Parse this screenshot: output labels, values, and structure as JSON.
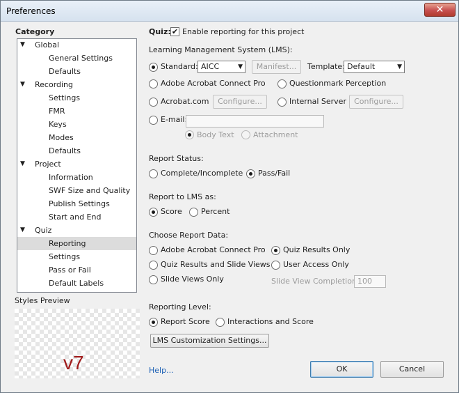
{
  "window": {
    "title": "Preferences",
    "close_glyph": "✕"
  },
  "category": {
    "heading": "Category",
    "items": [
      {
        "label": "Global",
        "group": true
      },
      {
        "label": "General Settings"
      },
      {
        "label": "Defaults"
      },
      {
        "label": "Recording",
        "group": true
      },
      {
        "label": "Settings"
      },
      {
        "label": "FMR"
      },
      {
        "label": "Keys"
      },
      {
        "label": "Modes"
      },
      {
        "label": "Defaults"
      },
      {
        "label": "Project",
        "group": true
      },
      {
        "label": "Information"
      },
      {
        "label": "SWF Size and Quality"
      },
      {
        "label": "Publish Settings"
      },
      {
        "label": "Start and End"
      },
      {
        "label": "Quiz",
        "group": true
      },
      {
        "label": "Reporting",
        "selected": true
      },
      {
        "label": "Settings"
      },
      {
        "label": "Pass or Fail"
      },
      {
        "label": "Default Labels"
      }
    ]
  },
  "styles_preview": {
    "label": "Styles Preview",
    "text": "v7"
  },
  "quiz": {
    "label": "Quiz:",
    "enable_label": "Enable reporting for this project",
    "checked": true,
    "check_glyph": "✔"
  },
  "lms": {
    "heading": "Learning Management System (LMS):",
    "standard_label": "Standard:",
    "standard_value": "AICC",
    "manifest_button": "Manifest...",
    "template_label": "Template:",
    "template_value": "Default",
    "acrobat_connect": "Adobe Acrobat Connect Pro",
    "questionmark": "Questionmark Perception",
    "acrobat_com": "Acrobat.com",
    "configure_button_1": "Configure...",
    "internal_server": "Internal Server",
    "configure_button_2": "Configure...",
    "email_label": "E-mail:",
    "email_value": "",
    "body_text": "Body Text",
    "attachment": "Attachment",
    "dropdown_glyph": "▼"
  },
  "report_status": {
    "heading": "Report Status:",
    "complete": "Complete/Incomplete",
    "passfail": "Pass/Fail"
  },
  "report_as": {
    "heading": "Report to LMS as:",
    "score": "Score",
    "percent": "Percent"
  },
  "report_data": {
    "heading": "Choose Report Data:",
    "acrobat_connect": "Adobe Acrobat Connect Pro",
    "quiz_results_only": "Quiz Results Only",
    "quiz_and_slides": "Quiz Results and Slide Views",
    "user_access_only": "User Access Only",
    "slide_views_only": "Slide Views Only",
    "slide_view_completion_label": "Slide View Completion",
    "slide_view_completion_value": "100"
  },
  "reporting_level": {
    "heading": "Reporting Level:",
    "report_score": "Report Score",
    "interactions": "Interactions and Score",
    "lms_button": "LMS Customization Settings..."
  },
  "footer": {
    "help": "Help...",
    "ok": "OK",
    "cancel": "Cancel"
  }
}
